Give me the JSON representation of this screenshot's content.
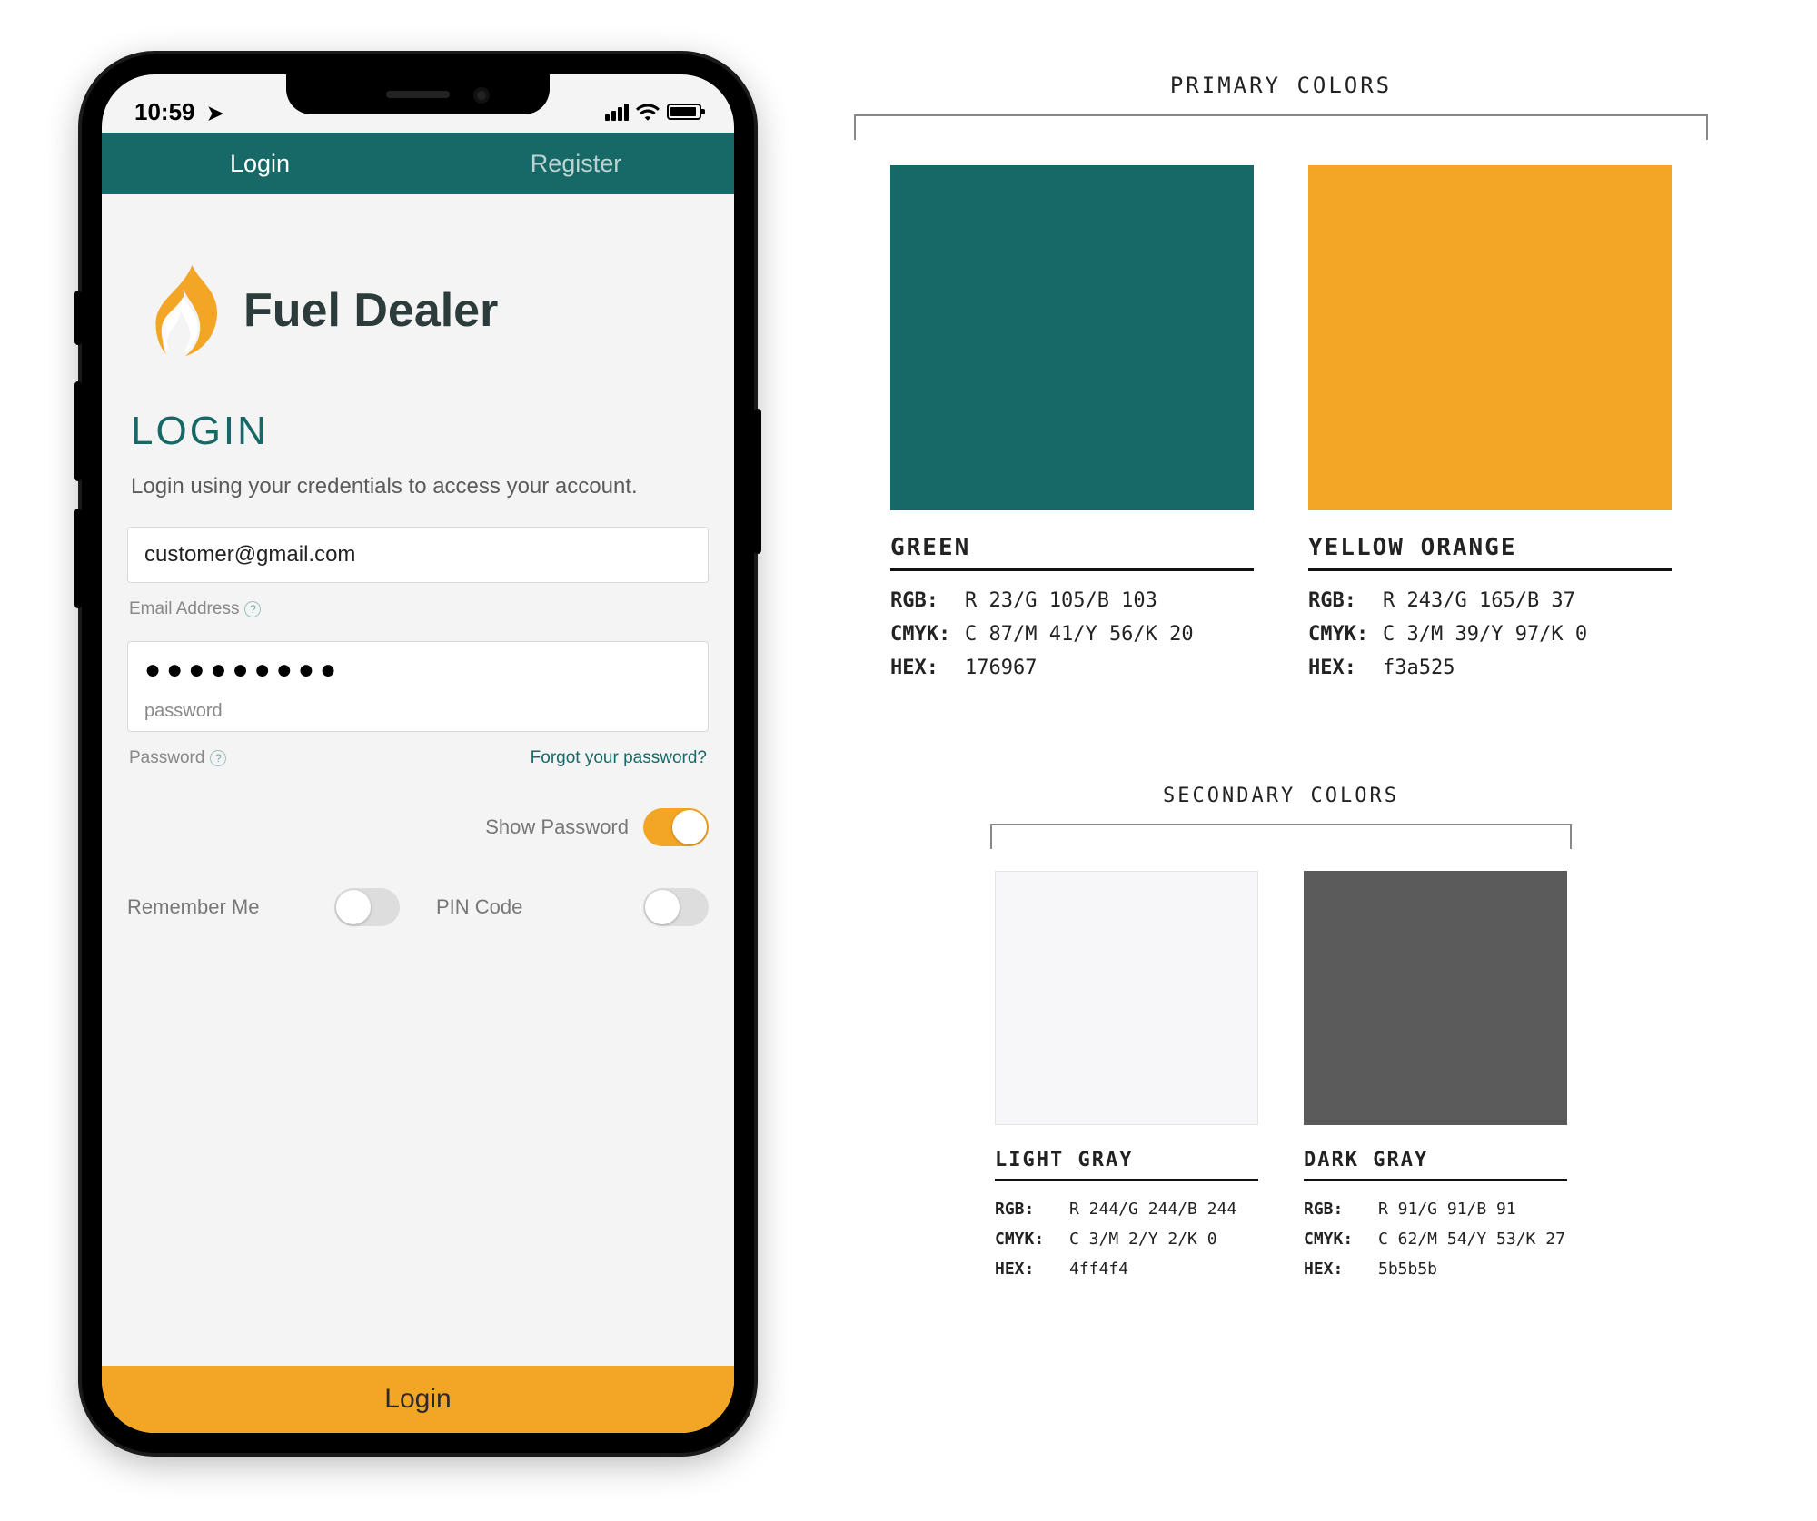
{
  "statusBar": {
    "time": "10:59"
  },
  "tabs": {
    "login": "Login",
    "register": "Register"
  },
  "brand": {
    "name": "Fuel Dealer"
  },
  "login": {
    "heading": "LOGIN",
    "subtitle": "Login using your credentials to access your account.",
    "emailValue": "customer@gmail.com",
    "emailHint": "Email Address",
    "passwordMasked": "●●●●●●●●●",
    "passwordPlaceholder": "password",
    "passwordHint": "Password",
    "forgot": "Forgot your password?",
    "showPassword": "Show Password",
    "rememberMe": "Remember Me",
    "pinCode": "PIN Code",
    "button": "Login"
  },
  "palette": {
    "primaryTitle": "PRIMARY COLORS",
    "secondaryTitle": "SECONDARY COLORS",
    "primary": [
      {
        "name": "GREEN",
        "rgb": "R 23/G 105/B 103",
        "cmyk": "C 87/M 41/Y 56/K 20",
        "hex": "176967",
        "swatchHex": "#176967"
      },
      {
        "name": "YELLOW ORANGE",
        "rgb": "R 243/G 165/B 37",
        "cmyk": "C 3/M 39/Y 97/K 0",
        "hex": "f3a525",
        "swatchHex": "#f3a525"
      }
    ],
    "secondary": [
      {
        "name": "LIGHT GRAY",
        "rgb": "R 244/G 244/B 244",
        "cmyk": "C 3/M 2/Y 2/K 0",
        "hex": "4ff4f4",
        "swatchHex": "#f7f7f9"
      },
      {
        "name": "DARK GRAY",
        "rgb": "R 91/G 91/B 91",
        "cmyk": "C 62/M 54/Y 53/K 27",
        "hex": "5b5b5b",
        "swatchHex": "#5b5b5b"
      }
    ]
  },
  "labels": {
    "rgb": "RGB:",
    "cmyk": "CMYK:",
    "hex": "HEX:"
  }
}
